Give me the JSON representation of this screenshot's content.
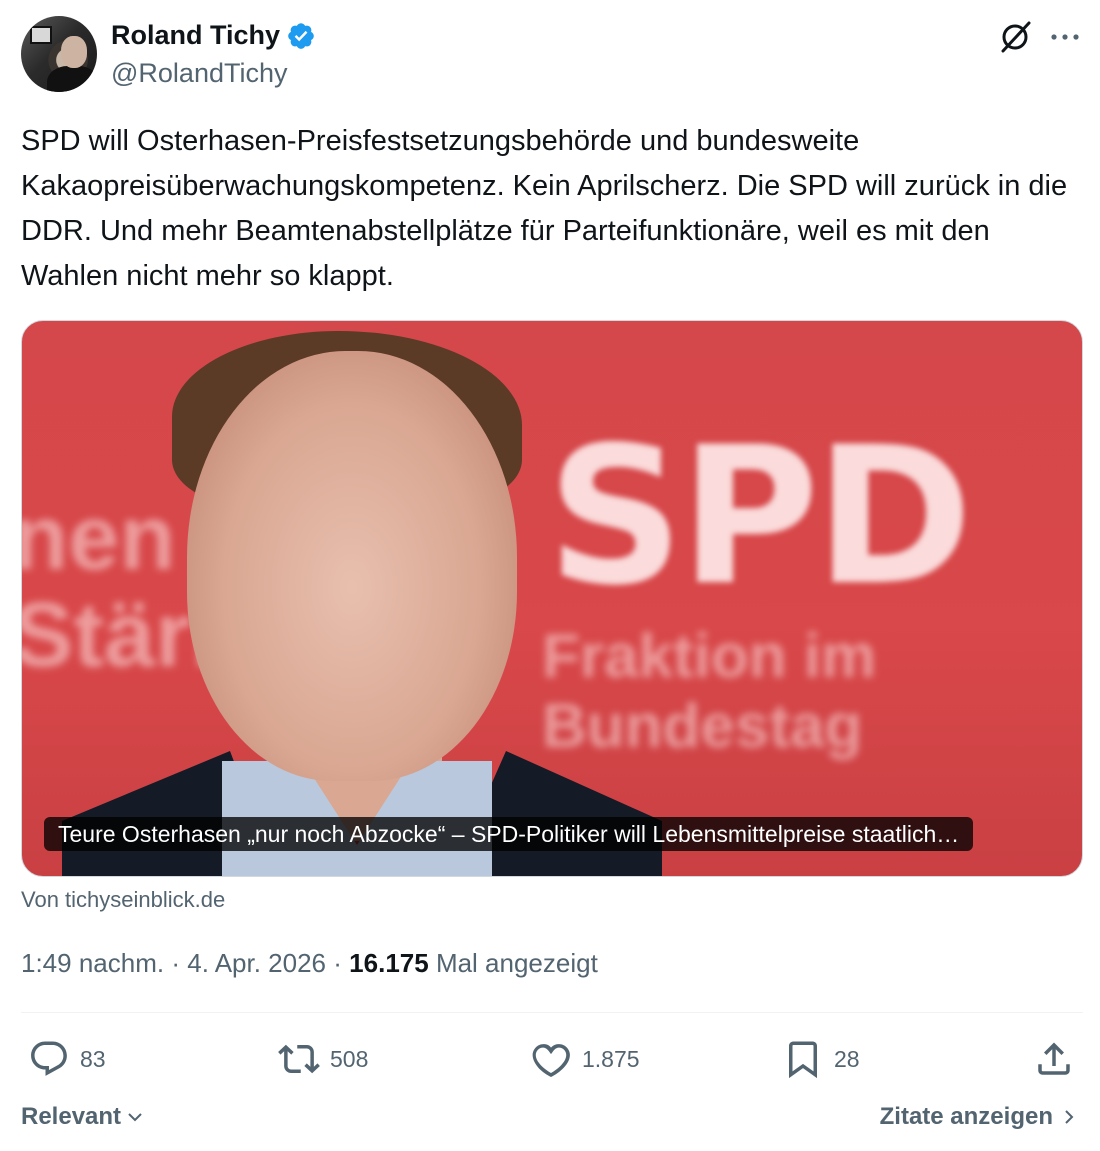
{
  "author": {
    "display_name": "Roland Tichy",
    "handle": "@RolandTichy",
    "verified": true
  },
  "tweet": {
    "text": "SPD will Osterhasen-Preisfestsetzungsbehörde und bundesweite Kakaopreisüberwachungskompetenz. Kein Aprilscherz. Die SPD will zurück in die DDR. Und mehr Beamtenabstellplätze für Parteifunktionäre, weil es mit den Wahlen nicht mehr so klappt.",
    "time": "1:49 nachm.",
    "date": "4. Apr. 2026",
    "separator": "·",
    "views_count": "16.175",
    "views_label": "Mal angezeigt"
  },
  "card": {
    "caption": "Teure Osterhasen „nur noch Abzocke“ – SPD-Politiker will Lebensmittelpreise staatlich…",
    "source": "Von tichyseinblick.de",
    "image_text": {
      "logo": "SPD",
      "line1": "Fraktion im",
      "line2": "Bundestag",
      "left1": "nen",
      "left2": "Stärk"
    }
  },
  "actions": {
    "replies": "83",
    "retweets": "508",
    "likes": "1.875",
    "bookmarks": "28"
  },
  "footer": {
    "sort_label": "Relevant",
    "quotes_label": "Zitate anzeigen"
  },
  "colors": {
    "verified": "#1d9bf0",
    "text_primary": "#0f1419",
    "text_secondary": "#536471",
    "image_bg": "#d9484a"
  },
  "icons": [
    "verified-icon",
    "grok-icon",
    "more-icon",
    "reply-icon",
    "retweet-icon",
    "like-icon",
    "bookmark-icon",
    "share-icon",
    "chevron-down-icon",
    "chevron-right-icon"
  ]
}
